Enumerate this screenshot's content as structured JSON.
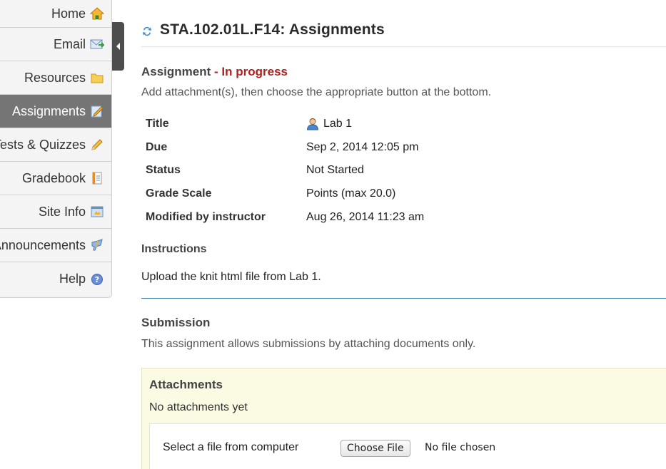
{
  "sidebar": {
    "items": [
      {
        "label": "Home",
        "icon": "home-icon",
        "active": false
      },
      {
        "label": "Email",
        "icon": "email-icon",
        "active": false
      },
      {
        "label": "Resources",
        "icon": "folder-icon",
        "active": false
      },
      {
        "label": "Assignments",
        "icon": "assignments-icon",
        "active": true
      },
      {
        "label": "Tests & Quizzes",
        "icon": "pencil-icon",
        "active": false
      },
      {
        "label": "Gradebook",
        "icon": "gradebook-icon",
        "active": false
      },
      {
        "label": "Site Info",
        "icon": "site-info-icon",
        "active": false
      },
      {
        "label": "Announcements",
        "icon": "announcements-icon",
        "active": false
      },
      {
        "label": "Help",
        "icon": "help-icon",
        "active": false
      }
    ]
  },
  "header": {
    "title": "STA.102.01L.F14: Assignments"
  },
  "assignment": {
    "heading": "Assignment",
    "status": " - In progress",
    "subtext": "Add attachment(s), then choose the appropriate button at the bottom.",
    "fields": [
      {
        "label": "Title",
        "value": "Lab 1"
      },
      {
        "label": "Due",
        "value": "Sep 2, 2014 12:05 pm"
      },
      {
        "label": "Status",
        "value": "Not Started"
      },
      {
        "label": "Grade Scale",
        "value": "Points (max 20.0)"
      },
      {
        "label": "Modified by instructor",
        "value": "Aug 26, 2014 11:23 am"
      }
    ],
    "instructions_heading": "Instructions",
    "instructions_text": "Upload the knit html file from Lab 1."
  },
  "submission": {
    "heading": "Submission",
    "text": "This assignment allows submissions by attaching documents only."
  },
  "attachments": {
    "heading": "Attachments",
    "empty_text": "No attachments yet",
    "file_label": "Select a file from computer",
    "choose_button": "Choose File",
    "no_file_text": "No file chosen"
  },
  "colors": {
    "status_red": "#b12020",
    "active_nav": "#757575",
    "attach_bg": "#fbfae3",
    "divider_blue": "#3b78a6"
  }
}
